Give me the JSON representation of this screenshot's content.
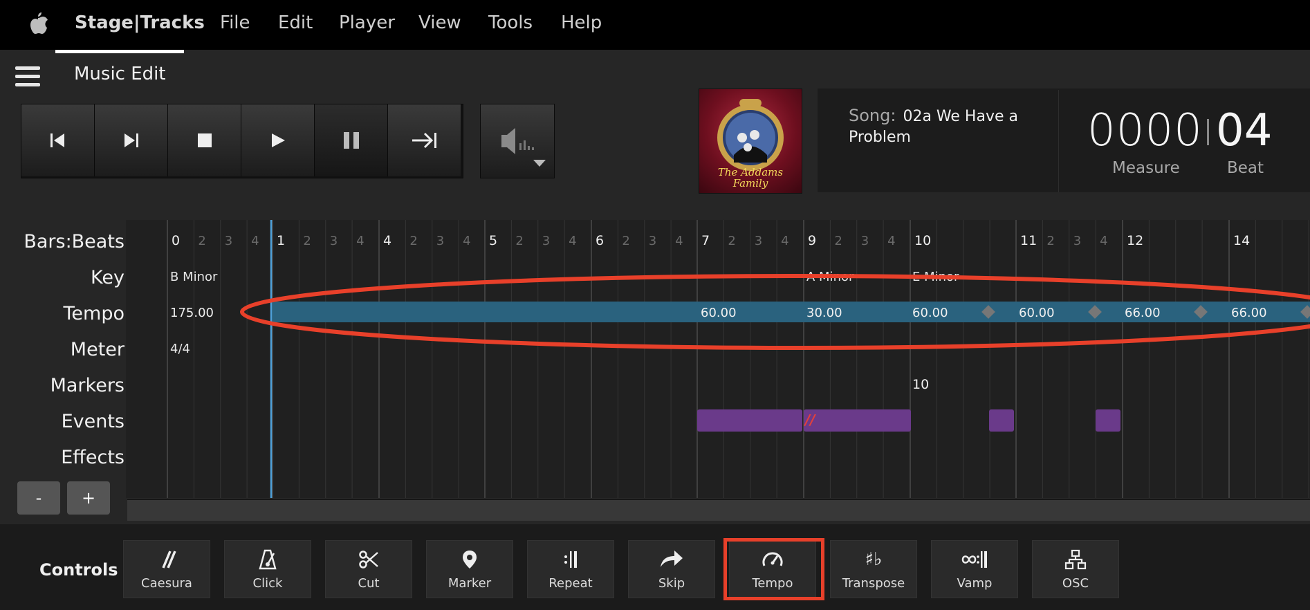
{
  "menubar": {
    "brand": "Stage|Tracks",
    "items": [
      "File",
      "Edit",
      "Player",
      "View",
      "Tools",
      "Help"
    ]
  },
  "header": {
    "title": "Music Edit"
  },
  "transport": {
    "buttons": [
      "skip-to-start",
      "next-track",
      "stop",
      "play",
      "pause",
      "jump-to-end"
    ]
  },
  "song": {
    "label": "Song:",
    "name": "02a We Have a Problem",
    "cover_title": "The Addams Family"
  },
  "counter": {
    "measure": "0000",
    "beat": "04",
    "measure_label": "Measure",
    "beat_label": "Beat"
  },
  "lanes": [
    "Bars:Beats",
    "Key",
    "Tempo",
    "Meter",
    "Markers",
    "Events",
    "Effects"
  ],
  "timeline": {
    "bars": [
      {
        "bar": "0",
        "beats": [
          "2",
          "3",
          "4"
        ]
      },
      {
        "bar": "1",
        "beats": [
          "2",
          "3",
          "4"
        ]
      },
      {
        "bar": "4",
        "beats": [
          "2",
          "3",
          "4"
        ]
      },
      {
        "bar": "5",
        "beats": [
          "2",
          "3",
          "4"
        ]
      },
      {
        "bar": "6",
        "beats": [
          "2",
          "3",
          "4"
        ]
      },
      {
        "bar": "7",
        "beats": [
          "2",
          "3",
          "4"
        ]
      },
      {
        "bar": "9",
        "beats": [
          "2",
          "3",
          "4"
        ]
      },
      {
        "bar": "10",
        "beats": []
      },
      {
        "bar": "11",
        "beats": [
          "2",
          "3",
          "4"
        ]
      },
      {
        "bar": "12",
        "beats": []
      },
      {
        "bar": "14",
        "beats": []
      }
    ],
    "keys": [
      "B Minor",
      "A Minor",
      "E Minor"
    ],
    "tempos": [
      "175.00",
      "60.00",
      "30.00",
      "60.00",
      "60.00",
      "66.00",
      "66.00"
    ],
    "meter": "4/4",
    "marker": "10",
    "event_symbol": "//"
  },
  "zoom": {
    "minus": "-",
    "plus": "+"
  },
  "controls": {
    "label": "Controls",
    "buttons": [
      "Caesura",
      "Click",
      "Cut",
      "Marker",
      "Repeat",
      "Skip",
      "Tempo",
      "Transpose",
      "Vamp",
      "OSC"
    ]
  },
  "colors": {
    "tempo_lane": "#2a627e",
    "playhead": "#4ea0d8",
    "event": "#6a3a8a",
    "highlight": "#e8402a"
  }
}
